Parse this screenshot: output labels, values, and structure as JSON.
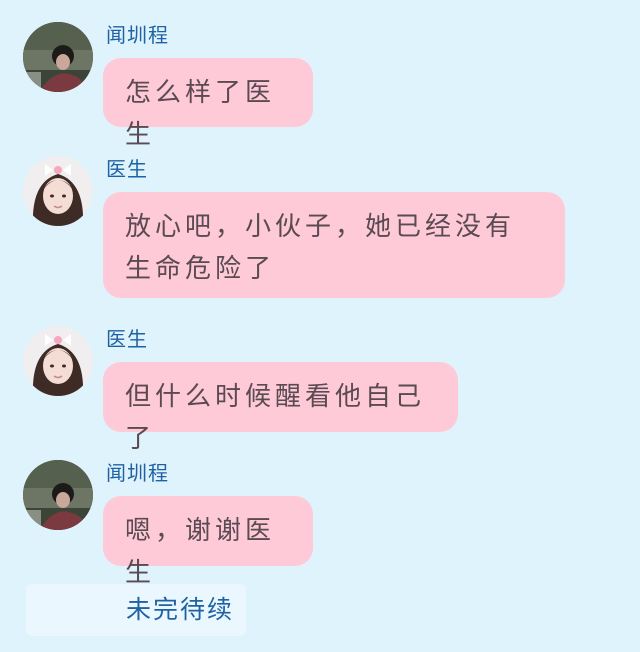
{
  "messages": [
    {
      "sender": "闻圳程",
      "avatar": "male-avatar",
      "text": "怎么样了医生"
    },
    {
      "sender": "医生",
      "avatar": "female-avatar",
      "text": "放心吧，小伙子，她已经没有生命危险了"
    },
    {
      "sender": "医生",
      "avatar": "female-avatar",
      "text": "但什么时候醒看他自己了"
    },
    {
      "sender": "闻圳程",
      "avatar": "male-avatar",
      "text": "嗯，谢谢医生"
    }
  ],
  "footer": {
    "text": "未完待续"
  },
  "colors": {
    "background": "#dff3fd",
    "bubble": "#ffcad8",
    "name": "#1e62a3",
    "text": "#5a4a52"
  }
}
